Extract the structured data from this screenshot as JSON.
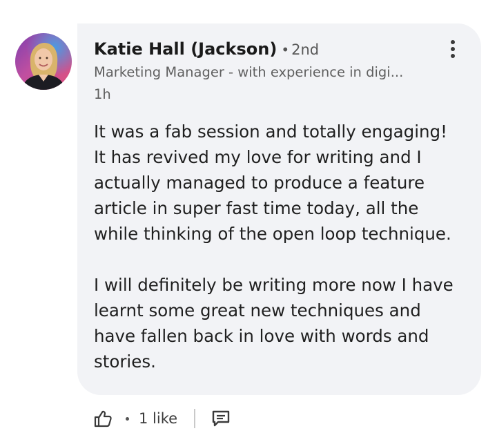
{
  "comment": {
    "author_name": "Katie Hall (Jackson)",
    "separator": "•",
    "connection_degree": "2nd",
    "headline": "Marketing Manager - with experience in digi...",
    "timestamp": "1h",
    "avatar_alt": "Katie Hall (Jackson)",
    "body": {
      "lines": [
        "It was a fab session and totally engaging!",
        "It has revived my love for writing and I",
        "actually managed to produce a feature",
        "article in super fast time today, all the",
        "while thinking of the open loop technique.",
        "",
        "I will definitely be writing more now I have",
        "learnt some great new techniques and",
        "have fallen back in love with words and",
        "stories."
      ]
    }
  },
  "actions": {
    "like_icon": "thumbs-up-icon",
    "separator": "•",
    "like_count": "1 like",
    "reply_icon": "comment-icon",
    "more_icon": "more-vertical-icon"
  },
  "colors": {
    "bubble_bg": "#f2f3f6",
    "text_primary": "#1f1f1f",
    "text_secondary": "#5f5f5f"
  }
}
